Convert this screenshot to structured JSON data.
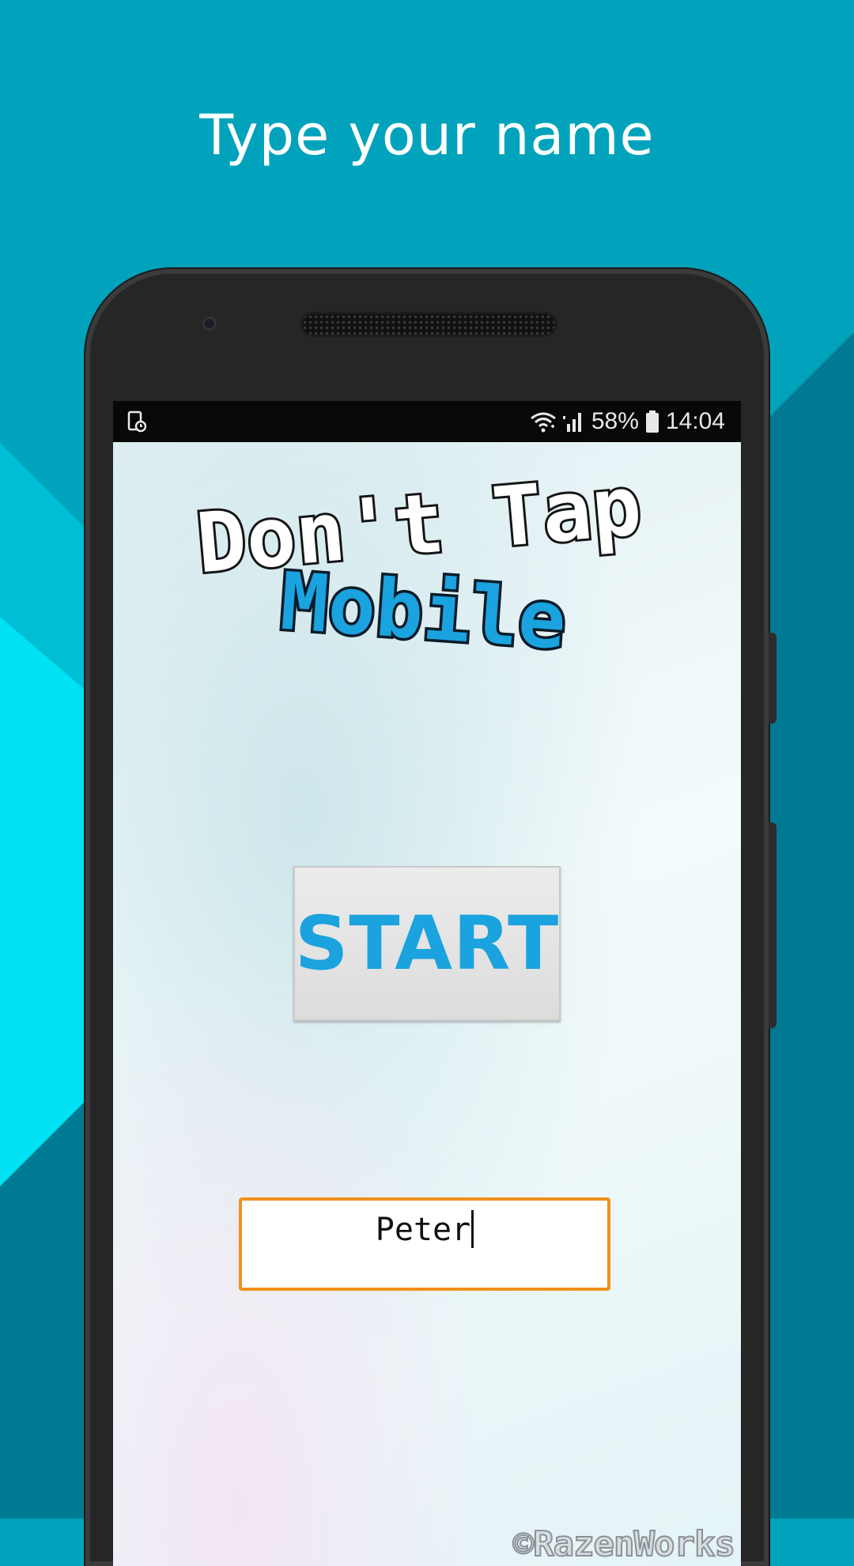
{
  "promo": {
    "headline": "Type your name"
  },
  "colors": {
    "background": "#00a3bb",
    "accent_cyan": "#00f0ff",
    "accent_dark": "#007a92",
    "start_text": "#1aa3de",
    "field_border": "#f0901c"
  },
  "statusbar": {
    "left_icon": "notification-icon",
    "battery_percent": "58%",
    "time": "14:04",
    "icons": [
      "wifi-icon",
      "signal-icon",
      "battery-icon"
    ]
  },
  "app": {
    "logo_line1": "Don't Tap",
    "logo_line2": "Mobile",
    "start_label": "START",
    "name_input_value": "Peter",
    "copyright": "©RazenWorks"
  }
}
